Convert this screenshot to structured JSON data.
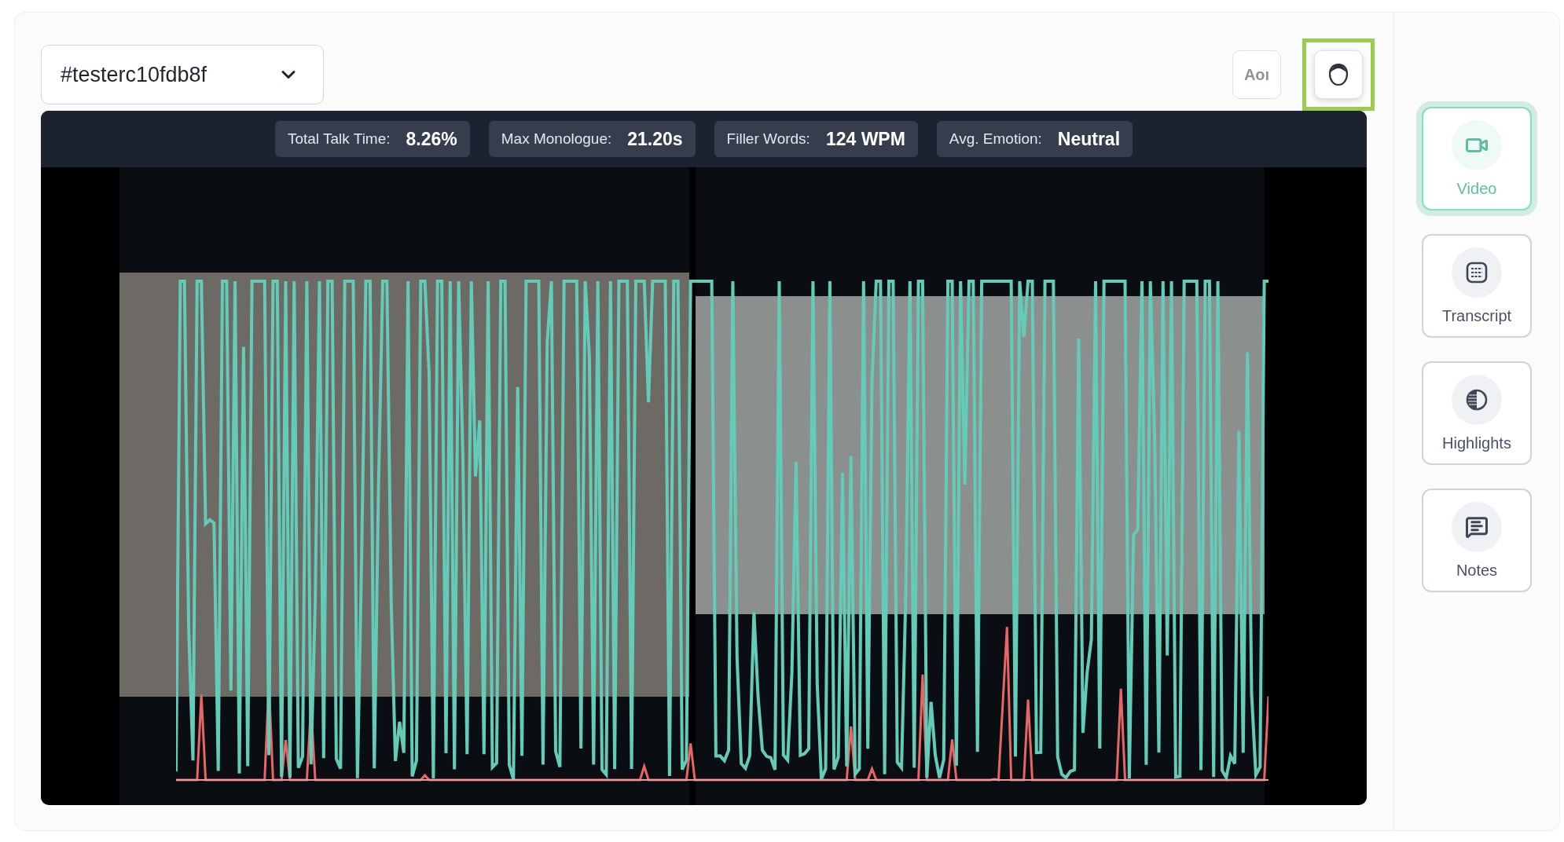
{
  "session_select": {
    "value": "#testerc10fdb8f"
  },
  "toolbar": [
    {
      "kind": "text",
      "label": "Aoı",
      "highlighted": false
    },
    {
      "kind": "icon",
      "highlighted": true
    }
  ],
  "stats": [
    {
      "label": "Total Talk Time:",
      "value": "8.26%"
    },
    {
      "label": "Max Monologue:",
      "value": "21.20s"
    },
    {
      "label": "Filler Words:",
      "value": "124 WPM"
    },
    {
      "label": "Avg. Emotion:",
      "value": "Neutral"
    }
  ],
  "video_tiles": [
    {
      "kind": "participant"
    },
    {
      "kind": "participant"
    }
  ],
  "sidebar": {
    "items": [
      {
        "label": "Video",
        "kind": "video",
        "selected": true
      },
      {
        "label": "Transcript",
        "kind": "transcript",
        "selected": false
      },
      {
        "label": "Highlights",
        "kind": "highlights",
        "selected": false
      },
      {
        "label": "Notes",
        "kind": "notes",
        "selected": false
      }
    ]
  }
}
